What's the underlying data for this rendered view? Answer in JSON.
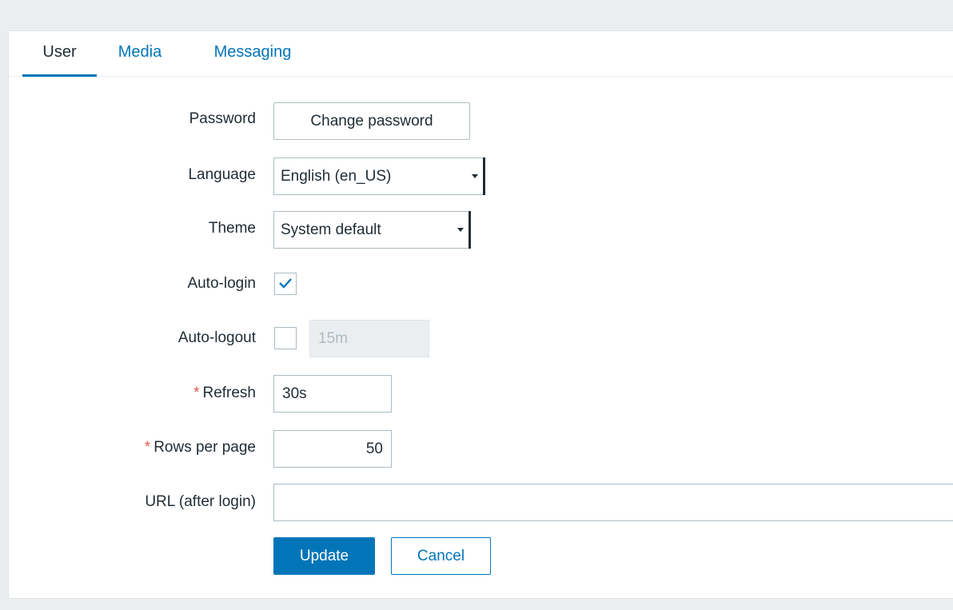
{
  "tabs": [
    {
      "label": "User",
      "active": true
    },
    {
      "label": "Media",
      "active": false
    },
    {
      "label": "Messaging",
      "active": false
    }
  ],
  "form": {
    "password": {
      "label": "Password",
      "button": "Change password"
    },
    "language": {
      "label": "Language",
      "value": "English (en_US)"
    },
    "theme": {
      "label": "Theme",
      "value": "System default"
    },
    "autologin": {
      "label": "Auto-login",
      "checked": true
    },
    "autologout": {
      "label": "Auto-logout",
      "checked": false,
      "value": "15m"
    },
    "refresh": {
      "required_mark": "*",
      "label": "Refresh",
      "value": "30s"
    },
    "rows_per_page": {
      "required_mark": "*",
      "label": "Rows per page",
      "value": "50"
    },
    "url": {
      "label": "URL (after login)",
      "value": ""
    }
  },
  "actions": {
    "update": "Update",
    "cancel": "Cancel"
  },
  "colors": {
    "accent": "#0275b8",
    "required": "#e45959",
    "text": "#1f2c33",
    "border": "#acbbc2"
  }
}
